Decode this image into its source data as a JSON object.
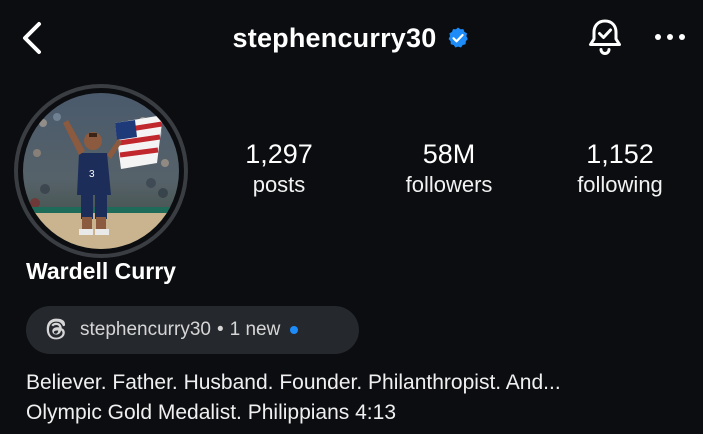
{
  "header": {
    "username": "stephencurry30",
    "verified_color": "#1d8cf8",
    "back_icon": "chevron-left-icon",
    "notification_icon": "bell-check-icon",
    "more_icon": "more-horizontal-icon"
  },
  "profile": {
    "display_name": "Wardell Curry",
    "stats": [
      {
        "value": "1,297",
        "label": "posts"
      },
      {
        "value": "58M",
        "label": "followers"
      },
      {
        "value": "1,152",
        "label": "following"
      }
    ]
  },
  "threads_badge": {
    "handle": "stephencurry30",
    "separator": "•",
    "status": "1 new",
    "indicator_color": "#1d8cf8"
  },
  "bio": {
    "line1": "Believer. Father. Husband. Founder. Philanthropist. And...",
    "line2": "Olympic Gold Medalist. Philippians 4:13"
  }
}
